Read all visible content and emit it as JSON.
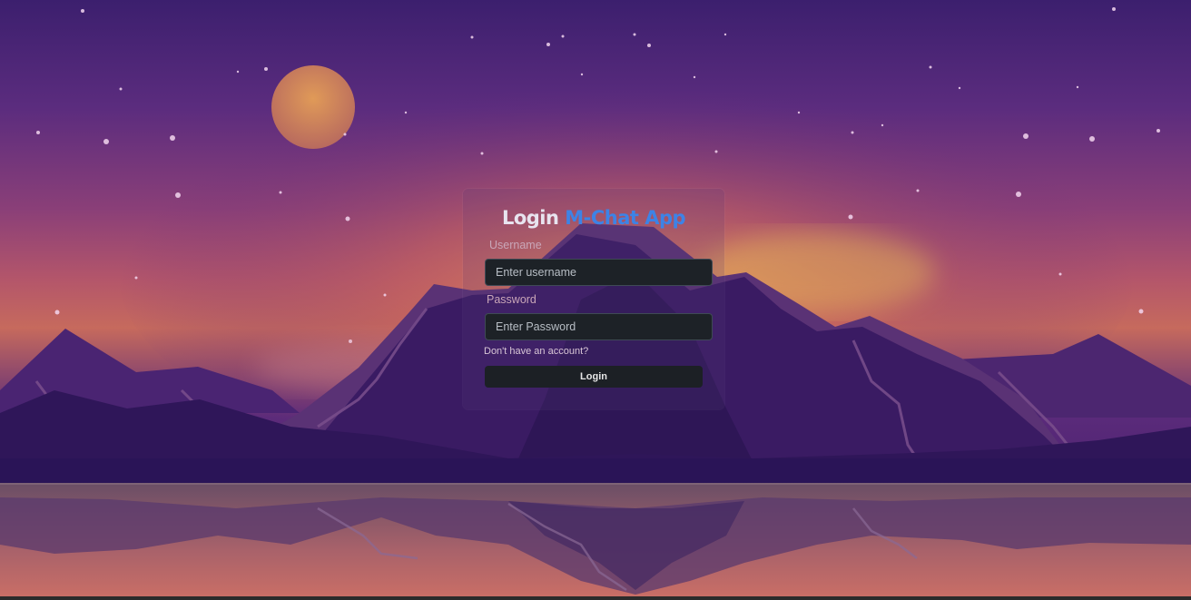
{
  "login": {
    "title_prefix": "Login",
    "title_brand": "M-Chat App",
    "username_label": "Username",
    "username_placeholder": "Enter username",
    "username_value": "",
    "password_label": "Password",
    "password_placeholder": "Enter Password",
    "password_value": "",
    "signup_link": "Don't have an account?",
    "login_button": "Login"
  },
  "colors": {
    "brand_accent": "#3d83e6",
    "input_background": "#1d2227",
    "button_background": "#1c2025",
    "sky_top": "#3c1f6e",
    "horizon_glow": "#c66a5d",
    "mountain_dark": "#2e1656"
  }
}
